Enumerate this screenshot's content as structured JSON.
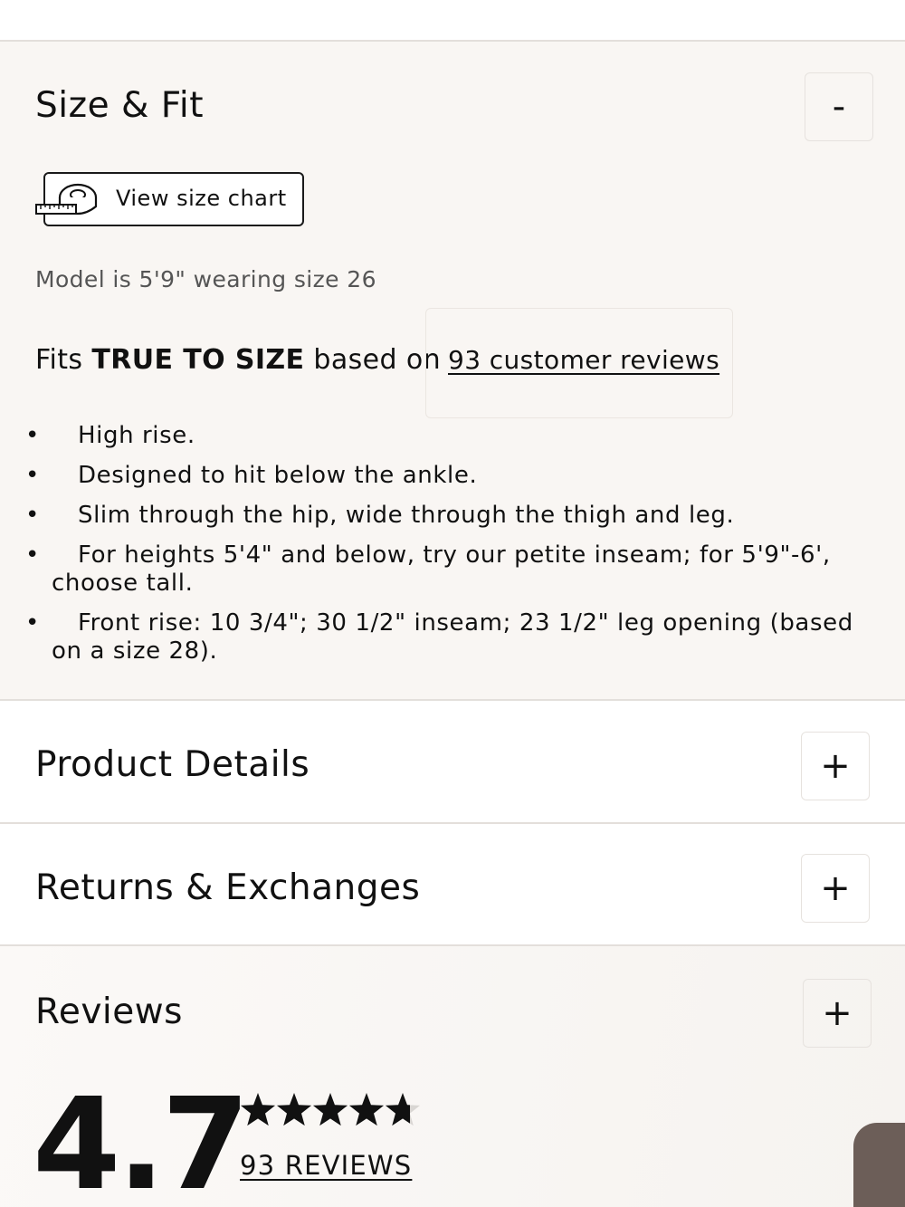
{
  "size_fit": {
    "title": "Size & Fit",
    "toggle": "-",
    "size_chart_label": "View size chart",
    "model_note": "Model is 5'9\" wearing size 26",
    "fit_prefix": "Fits ",
    "fit_emphasis": "TRUE TO SIZE",
    "fit_suffix": " based on",
    "reviews_link": "93 customer reviews",
    "features": [
      "High rise.",
      "Designed to hit below the ankle.",
      "Slim through the hip, wide through the thigh and leg.",
      "For heights 5'4\" and below, try our petite inseam; for 5'9\"-6', choose tall.",
      "Front rise: 10 3/4\"; 30 1/2\" inseam; 23 1/2\" leg opening (based on a size 28)."
    ]
  },
  "product_details": {
    "title": "Product Details",
    "toggle": "+"
  },
  "returns": {
    "title": "Returns & Exchanges",
    "toggle": "+"
  },
  "reviews": {
    "title": "Reviews",
    "toggle": "+",
    "average": "4.7",
    "rating_value": 4.7,
    "rating_max": 5,
    "count_label": "93 REVIEWS"
  },
  "icons": {
    "size_chart": "measuring-tape-icon",
    "star": "star-icon"
  },
  "colors": {
    "section_bg": "#f9f6f3",
    "divider": "#e3dfdb",
    "text": "#111111"
  }
}
